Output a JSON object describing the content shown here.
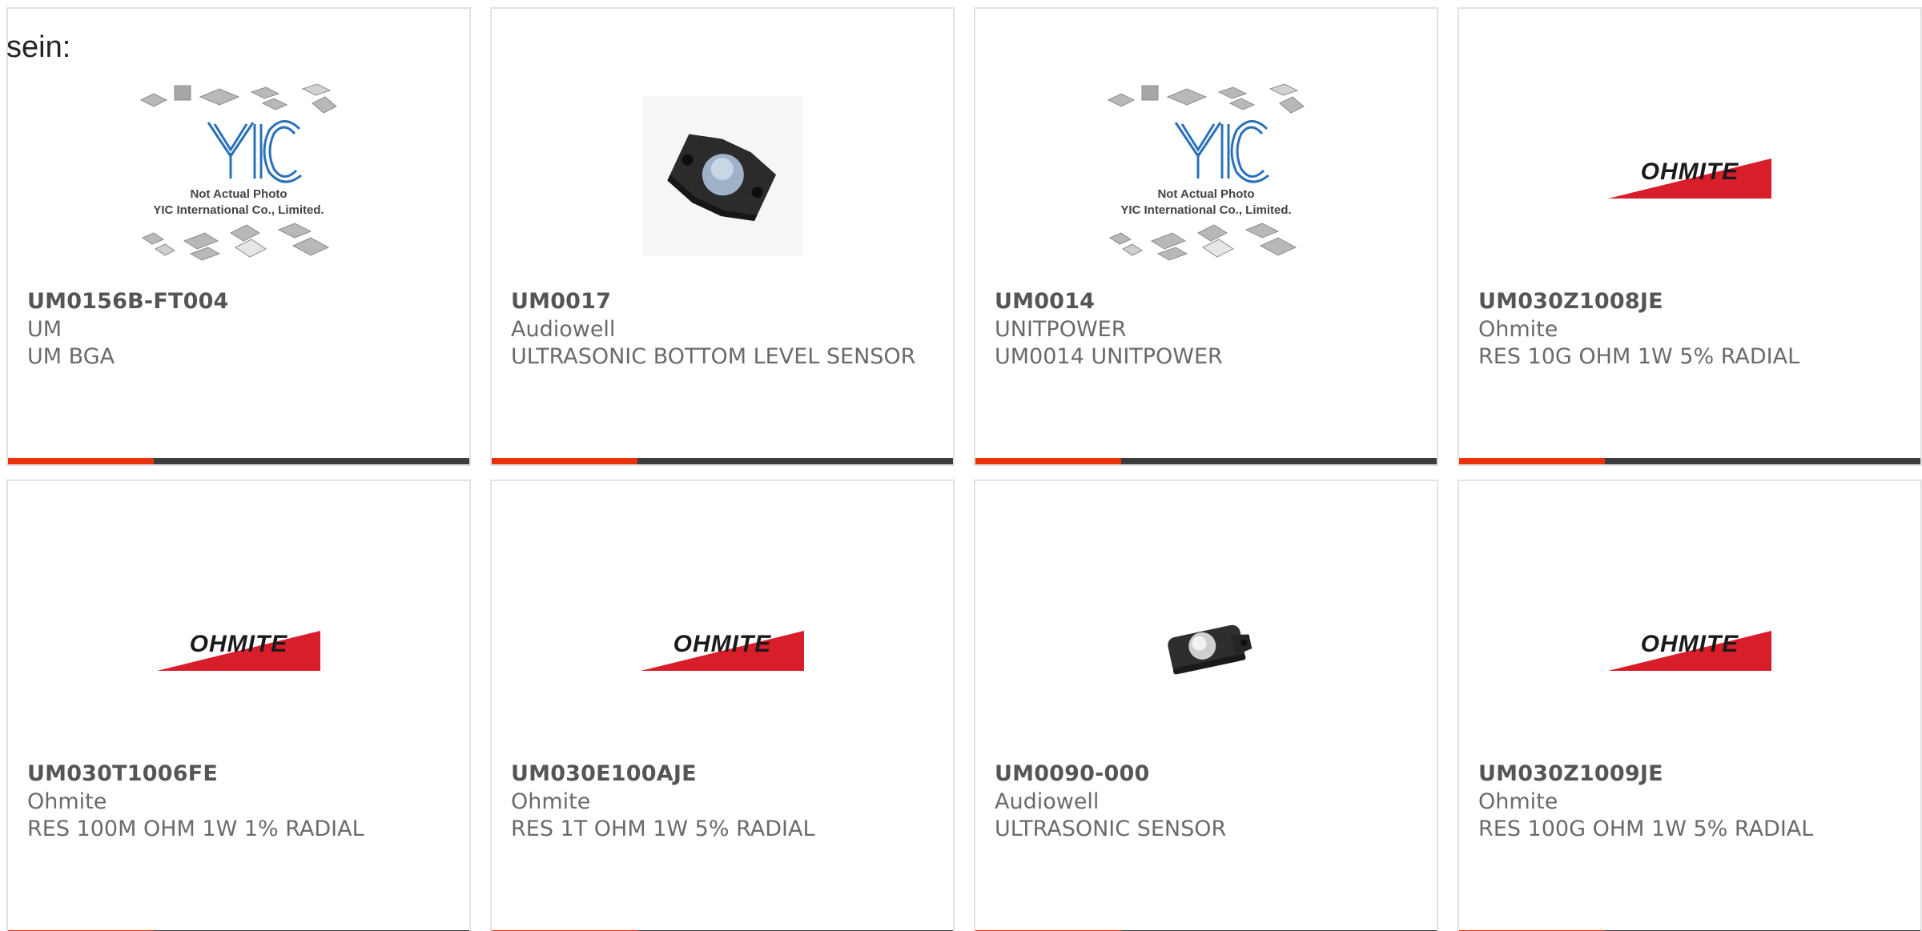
{
  "intro_text": "sein:",
  "accent_color": "#e8330c",
  "bar_color": "#3d3d3d",
  "yic_placeholder": {
    "line1": "Not Actual Photo",
    "line2": "YIC International Co., Limited."
  },
  "ohmite_logo_text": "OHMITE",
  "products": [
    {
      "part": "UM0156B-FT004",
      "manufacturer": "UM",
      "description": "UM BGA",
      "image": "yic-placeholder"
    },
    {
      "part": "UM0017",
      "manufacturer": "Audiowell",
      "description": "ULTRASONIC BOTTOM LEVEL SENSOR",
      "image": "sensor-photo"
    },
    {
      "part": "UM0014",
      "manufacturer": "UNITPOWER",
      "description": "UM0014 UNITPOWER",
      "image": "yic-placeholder"
    },
    {
      "part": "UM030Z1008JE",
      "manufacturer": "Ohmite",
      "description": "RES 10G OHM 1W 5% RADIAL",
      "image": "ohmite-logo"
    },
    {
      "part": "UM030T1006FE",
      "manufacturer": "Ohmite",
      "description": "RES 100M OHM 1W 1% RADIAL",
      "image": "ohmite-logo"
    },
    {
      "part": "UM030E100AJE",
      "manufacturer": "Ohmite",
      "description": "RES 1T OHM 1W 5% RADIAL",
      "image": "ohmite-logo"
    },
    {
      "part": "UM0090-000",
      "manufacturer": "Audiowell",
      "description": "ULTRASONIC SENSOR",
      "image": "sensor-photo-small"
    },
    {
      "part": "UM030Z1009JE",
      "manufacturer": "Ohmite",
      "description": "RES 100G OHM 1W 5% RADIAL",
      "image": "ohmite-logo"
    }
  ]
}
